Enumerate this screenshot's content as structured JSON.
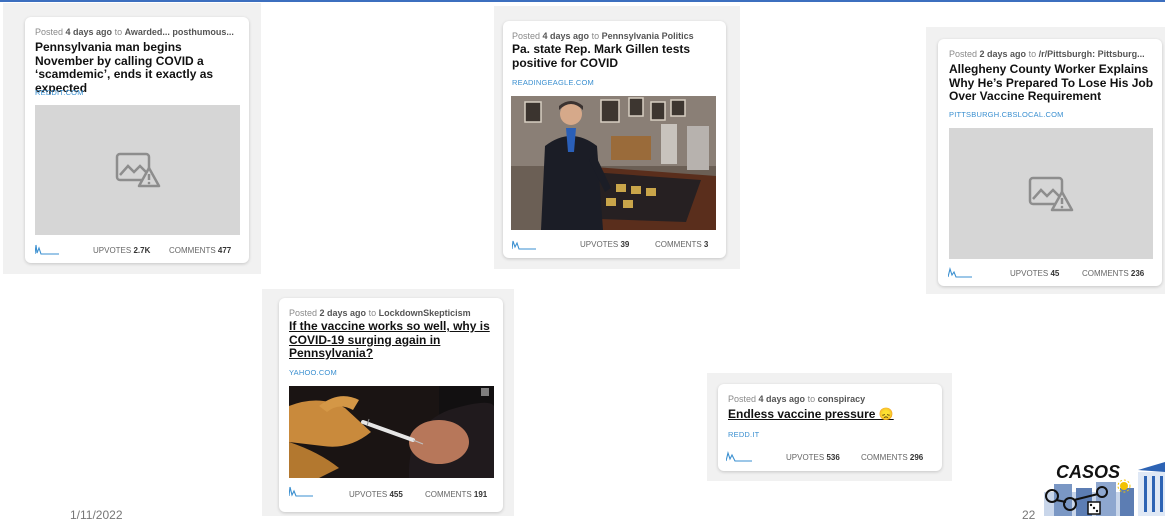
{
  "cards": [
    {
      "prefix": "Posted ",
      "age": "4 days ago",
      "to": " to ",
      "community": "Awarded... posthumous...",
      "title": "Pennsylvania man begins November by calling COVID a ‘scamdemic’, ends it exactly as expected",
      "domain": "REDDIT.COM",
      "upvotes_label": "UPVOTES ",
      "upvotes": "2.7K",
      "comments_label": "COMMENTS ",
      "comments": "477",
      "image": "broken-image-icon"
    },
    {
      "prefix": "Posted ",
      "age": "4 days ago",
      "to": " to ",
      "community": "Pennsylvania Politics",
      "title": "Pa. state Rep. Mark Gillen tests positive for COVID",
      "domain": "READINGEAGLE.COM",
      "upvotes_label": "UPVOTES ",
      "upvotes": "39",
      "comments_label": "COMMENTS ",
      "comments": "3",
      "image": "photo-man-museum"
    },
    {
      "prefix": "Posted ",
      "age": "2 days ago",
      "to": " to ",
      "community": "/r/Pittsburgh: Pittsburg...",
      "title": "Allegheny County Worker Explains Why He’s Prepared To Lose His Job Over Vaccine Requirement",
      "domain": "PITTSBURGH.CBSLOCAL.COM",
      "upvotes_label": "UPVOTES ",
      "upvotes": "45",
      "comments_label": "COMMENTS ",
      "comments": "236",
      "image": "broken-image-icon"
    },
    {
      "prefix": "Posted ",
      "age": "2 days ago",
      "to": " to ",
      "community": "LockdownSkepticism",
      "title": "If the vaccine works so well, why is COVID-19 surging again in Pennsylvania?",
      "domain": "YAHOO.COM",
      "upvotes_label": "UPVOTES ",
      "upvotes": "455",
      "comments_label": "COMMENTS ",
      "comments": "191",
      "image": "photo-vaccine-injection"
    },
    {
      "prefix": "Posted ",
      "age": "4 days ago",
      "to": " to ",
      "community": "conspiracy",
      "title": "Endless vaccine pressure 😞",
      "domain": "REDD.IT",
      "upvotes_label": "UPVOTES ",
      "upvotes": "536",
      "comments_label": "COMMENTS ",
      "comments": "296",
      "image": ""
    }
  ],
  "footer": {
    "date": "1/11/2022",
    "page": "22"
  },
  "logo": {
    "text": "CASOS"
  },
  "colors": {
    "link": "#3a8fd0",
    "spark": "#3a8fd0",
    "topline": "#3c6fbf"
  }
}
